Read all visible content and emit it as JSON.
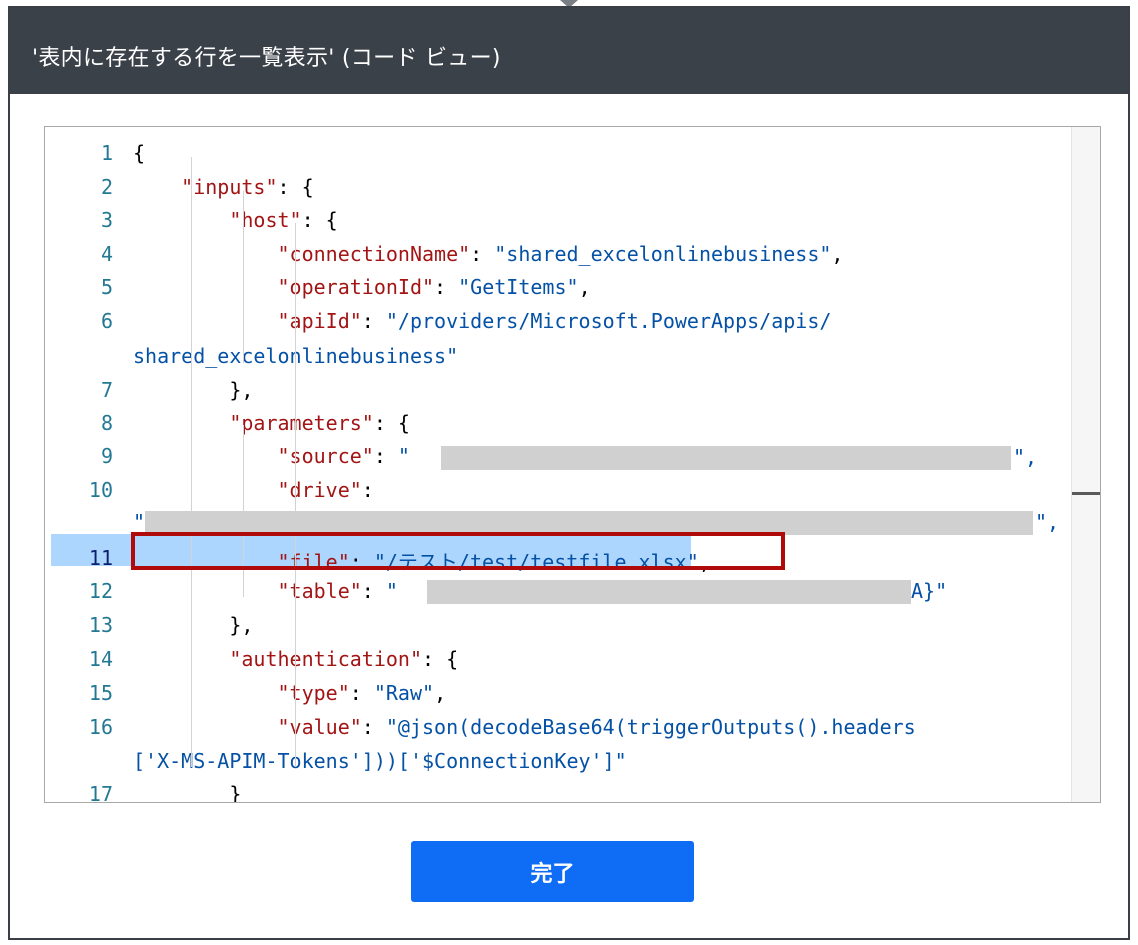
{
  "dialog": {
    "title": "'表内に存在する行を一覧表示' (コード ビュー)",
    "done_label": "完了"
  },
  "editor": {
    "line_numbers": [
      "1",
      "2",
      "3",
      "4",
      "5",
      "6",
      "7",
      "8",
      "9",
      "10",
      "11",
      "12",
      "13",
      "14",
      "15",
      "16",
      "17"
    ],
    "active_line": "11",
    "lines": [
      {
        "indent": "",
        "key": "",
        "sep": "{",
        "value": "",
        "tail": ""
      },
      {
        "indent": "    ",
        "key": "\"inputs\"",
        "sep": ": {",
        "value": "",
        "tail": ""
      },
      {
        "indent": "        ",
        "key": "\"host\"",
        "sep": ": {",
        "value": "",
        "tail": ""
      },
      {
        "indent": "            ",
        "key": "\"connectionName\"",
        "sep": ": ",
        "value": "\"shared_excelonlinebusiness\"",
        "tail": ","
      },
      {
        "indent": "            ",
        "key": "\"operationId\"",
        "sep": ": ",
        "value": "\"GetItems\"",
        "tail": ","
      },
      {
        "indent": "            ",
        "key": "\"apiId\"",
        "sep": ": ",
        "value": "\"/providers/Microsoft.PowerApps/apis/",
        "tail": ""
      },
      {
        "indent": "",
        "key": "",
        "sep": "",
        "value": "shared_excelonlinebusiness\"",
        "tail": ""
      },
      {
        "indent": "        ",
        "key": "",
        "sep": "},",
        "value": "",
        "tail": ""
      },
      {
        "indent": "        ",
        "key": "\"parameters\"",
        "sep": ": {",
        "value": "",
        "tail": ""
      },
      {
        "indent": "            ",
        "key": "\"source\"",
        "sep": ": ",
        "value": "\"",
        "tail": ""
      },
      {
        "indent": "            ",
        "key": "\"drive\"",
        "sep": ":",
        "value": "",
        "tail": ""
      },
      {
        "indent": "",
        "key": "",
        "sep": "",
        "value": "\"",
        "tail": ""
      },
      {
        "indent": "            ",
        "key": "\"file\"",
        "sep": ": ",
        "value": "\"/テスト/test/testfile.xlsx\"",
        "tail": ","
      },
      {
        "indent": "            ",
        "key": "\"table\"",
        "sep": ": ",
        "value": "\"",
        "tail": ""
      },
      {
        "indent": "        ",
        "key": "",
        "sep": "},",
        "value": "",
        "tail": ""
      },
      {
        "indent": "        ",
        "key": "\"authentication\"",
        "sep": ": {",
        "value": "",
        "tail": ""
      },
      {
        "indent": "            ",
        "key": "\"type\"",
        "sep": ": ",
        "value": "\"Raw\"",
        "tail": ","
      },
      {
        "indent": "            ",
        "key": "\"value\"",
        "sep": ": ",
        "value": "\"@json(decodeBase64(triggerOutputs().headers",
        "tail": ""
      },
      {
        "indent": "",
        "key": "",
        "sep": "",
        "value": "['X-MS-APIM-Tokens']))['$ConnectionKey']\"",
        "tail": ""
      },
      {
        "indent": "        ",
        "key": "",
        "sep": "}",
        "value": "",
        "tail": ""
      }
    ],
    "redacted_fragments": {
      "source_end": "\",",
      "drive_end": "\",",
      "table_end": "A}\""
    }
  }
}
